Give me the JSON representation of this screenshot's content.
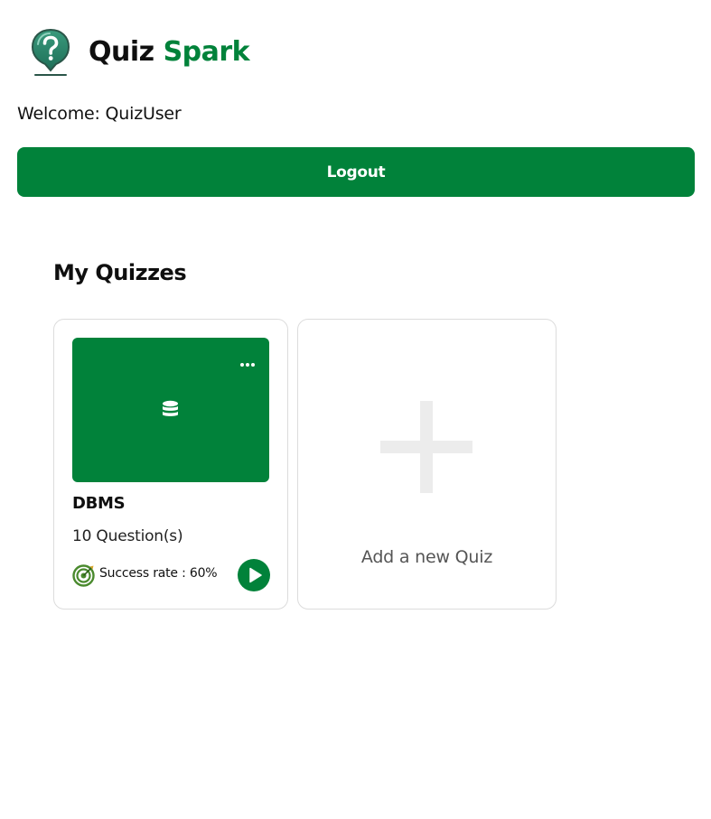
{
  "brand": {
    "name_part1": "Quiz",
    "name_part2": "Spark",
    "logo_icon": "question-bubble-icon",
    "accent_color": "#01823a"
  },
  "header": {
    "welcome_text": "Welcome: QuizUser",
    "logout_label": "Logout"
  },
  "main": {
    "section_title": "My Quizzes",
    "quizzes": [
      {
        "title": "DBMS",
        "question_count": "10 Question(s)",
        "success_rate": "Success rate : 60%",
        "thumbnail_icon": "database-icon",
        "thumbnail_color": "#01823a"
      }
    ],
    "add_card": {
      "label": "Add a new Quiz",
      "icon": "plus-icon"
    }
  }
}
